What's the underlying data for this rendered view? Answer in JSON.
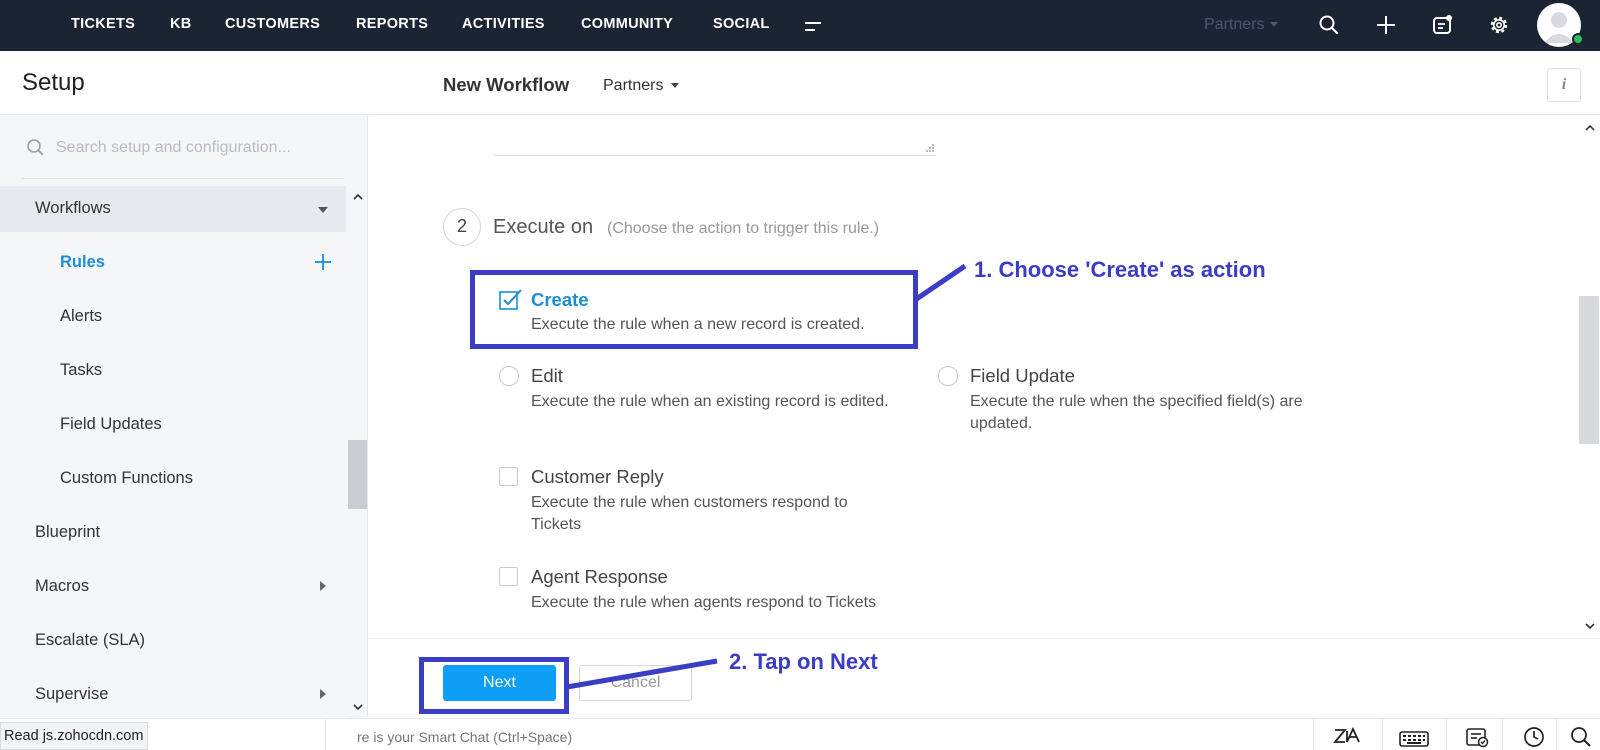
{
  "topnav": {
    "items": [
      "TICKETS",
      "KB",
      "CUSTOMERS",
      "REPORTS",
      "ACTIVITIES",
      "COMMUNITY",
      "SOCIAL"
    ],
    "portal_selector": "Partners"
  },
  "sidebar": {
    "title": "Setup",
    "search_placeholder": "Search setup and configuration...",
    "group_label": "Workflows",
    "sub_items": [
      "Rules",
      "Alerts",
      "Tasks",
      "Field Updates",
      "Custom Functions"
    ],
    "top_items": [
      "Blueprint",
      "Macros",
      "Escalate (SLA)",
      "Supervise"
    ]
  },
  "header": {
    "title": "New Workflow",
    "department": "Partners"
  },
  "step": {
    "number": "2",
    "title": "Execute on",
    "hint": "(Choose the action to trigger this rule.)"
  },
  "options": {
    "create": {
      "title": "Create",
      "desc": "Execute the rule when a new record is created.",
      "checked": true
    },
    "edit": {
      "title": "Edit",
      "desc": "Execute the rule when an existing record is edited."
    },
    "field_update": {
      "title": "Field Update",
      "desc": "Execute the rule when the specified field(s) are updated."
    },
    "customer_reply": {
      "title": "Customer Reply",
      "desc": "Execute the rule when customers respond to Tickets"
    },
    "agent_response": {
      "title": "Agent Response",
      "desc": "Execute the rule when agents respond to Tickets"
    }
  },
  "footer": {
    "next_label": "Next",
    "cancel_label": "Cancel"
  },
  "annotations": {
    "step1": "1. Choose 'Create' as action",
    "step2": "2. Tap on Next",
    "color": "#3b3dc4"
  },
  "statusbar": {
    "status_text": "Read js.zohocdn.com",
    "chat_hint": "re is your Smart Chat (Ctrl+Space)"
  },
  "colors": {
    "topbar": "#1b2432",
    "accent": "#1a8fd6",
    "primary_button": "#0d9ff5",
    "online": "#2fbe5c"
  },
  "icons": [
    "hamburger-icon",
    "search-icon",
    "plus-icon",
    "compose-icon",
    "gear-icon",
    "info-icon",
    "zia-icon",
    "keyboard-icon",
    "checklist-icon",
    "clock-icon"
  ]
}
